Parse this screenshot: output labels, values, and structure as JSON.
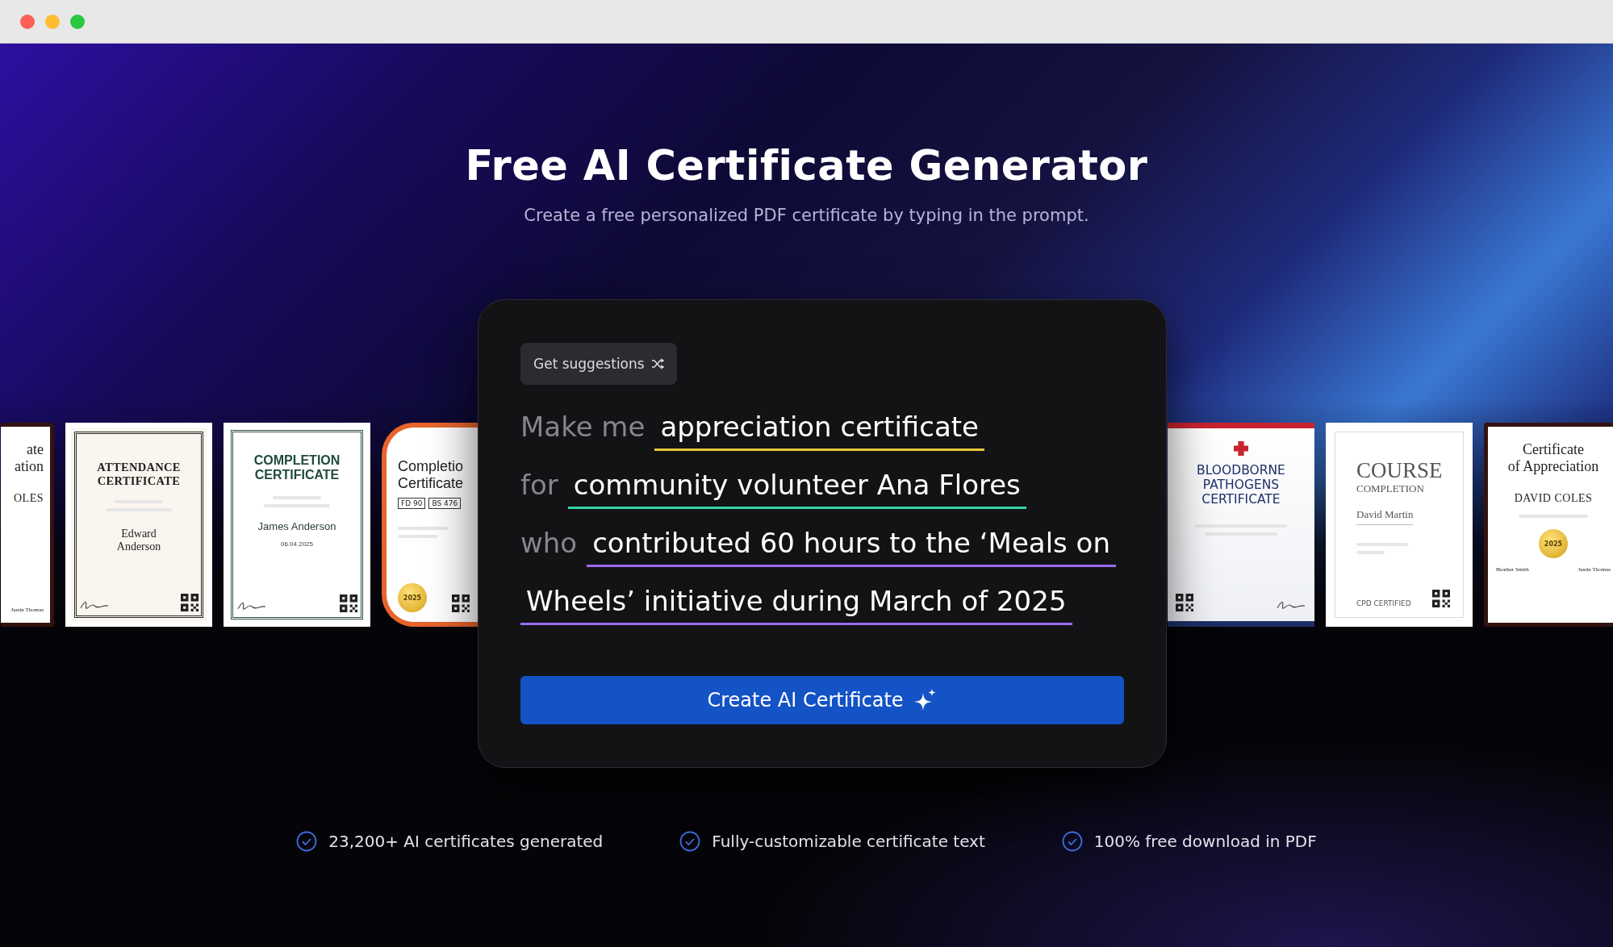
{
  "hero": {
    "title": "Free AI Certificate Generator",
    "subtitle": "Create a free personalized PDF certificate by typing in the prompt."
  },
  "certificates_left": [
    {
      "kind": "appreciation",
      "lines": [
        "ate",
        "ation"
      ],
      "name": "OLES",
      "signers": [
        "Justin Thomas"
      ]
    },
    {
      "kind": "attendance",
      "lines": [
        "ATTENDANCE",
        "CERTIFICATE"
      ],
      "name": "Edward Anderson"
    },
    {
      "kind": "completion-green",
      "lines": [
        "COMPLETION",
        "CERTIFICATE"
      ],
      "name": "James Anderson",
      "date": "06.04.2025"
    },
    {
      "kind": "completion-orange",
      "lines": [
        "Completio",
        "Certificate"
      ],
      "codes": [
        "FD 90",
        "BS 476"
      ],
      "seal": "2025"
    }
  ],
  "certificates_right": [
    {
      "kind": "bloodborne",
      "lines": [
        "BLOODBORNE",
        "PATHOGENS",
        "CERTIFICATE"
      ]
    },
    {
      "kind": "course",
      "lines": [
        "COURSE",
        "COMPLETION"
      ],
      "name": "David Martin",
      "badge": "CPD CERTIFIED"
    },
    {
      "kind": "appreciation",
      "lines": [
        "Certificate",
        "of Appreciation"
      ],
      "name": "DAVID COLES",
      "seal": "2025",
      "signers": [
        "Heather Smith",
        "Justin Thomas"
      ]
    }
  ],
  "prompt": {
    "suggestions_button": "Get suggestions",
    "lines": [
      {
        "label": "Make me",
        "value": "appreciation certificate",
        "color": "#e9c53c"
      },
      {
        "label": "for",
        "value": "community volunteer Ana Flores",
        "color": "#36d3a0"
      },
      {
        "label": "who",
        "value": "contributed 60 hours to the ‘Meals on",
        "color": "#9a6cf2"
      },
      {
        "value": "Wheels’ initiative during March of 2025",
        "color": "#9a6cf2"
      }
    ],
    "create_button": "Create AI Certificate"
  },
  "features": [
    "23,200+ AI certificates generated",
    "Fully-customizable certificate text",
    "100% free download in PDF"
  ]
}
